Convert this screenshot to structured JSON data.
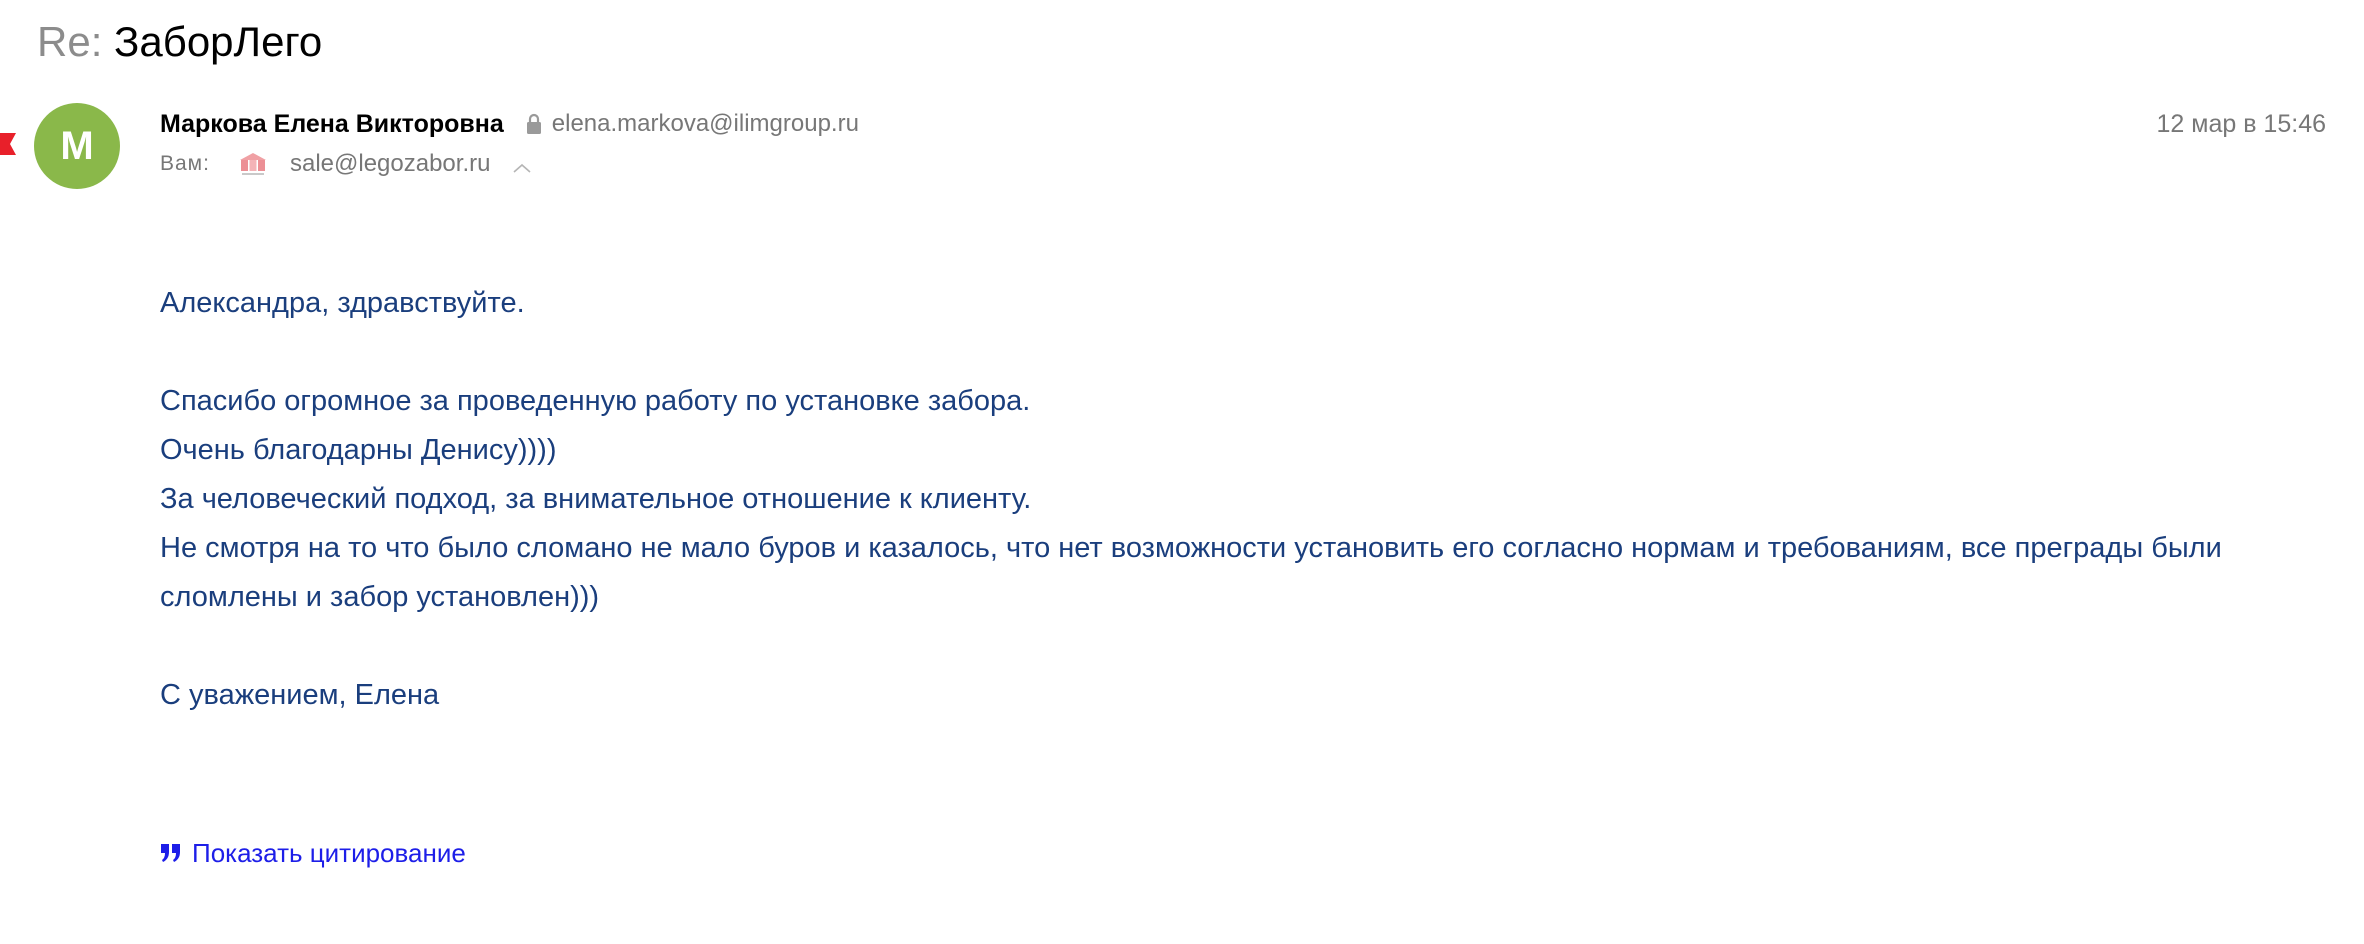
{
  "message": {
    "subject_prefix": "Re:",
    "subject": "ЗаборЛего",
    "sender": {
      "name": "Маркова Елена Викторовна",
      "email": "elena.markova@ilimgroup.ru",
      "avatar_letter": "М",
      "avatar_color": "#8ab84a"
    },
    "date": "12 мар в 15:46",
    "to": {
      "label": "Вам:",
      "recipient_email": "sale@legozabor.ru"
    },
    "body": {
      "greeting": "Александра, здравствуйте.",
      "lines": [
        "Спасибо огромное за проведенную работу по установке забора.",
        "Очень благодарны Денису))))",
        "За человеческий подход, за внимательное отношение к клиенту.",
        "Не смотря на то что было сломано не мало буров и казалось, что нет возможности установить его согласно нормам и требованиям, все преграды были сломлены и забор установлен)))"
      ],
      "signature": "С уважением, Елена"
    },
    "show_quote_label": "Показать цитирование"
  },
  "colors": {
    "body_text": "#1a3e7d",
    "link": "#1d1ee8",
    "meta_text": "#777777",
    "flag": "#e8202a"
  },
  "icons": {
    "flag": "red-flag-icon",
    "lock": "lock-icon",
    "recipient_logo": "company-logo-icon",
    "toggle": "chevron-up-icon",
    "quote": "quote-icon"
  }
}
